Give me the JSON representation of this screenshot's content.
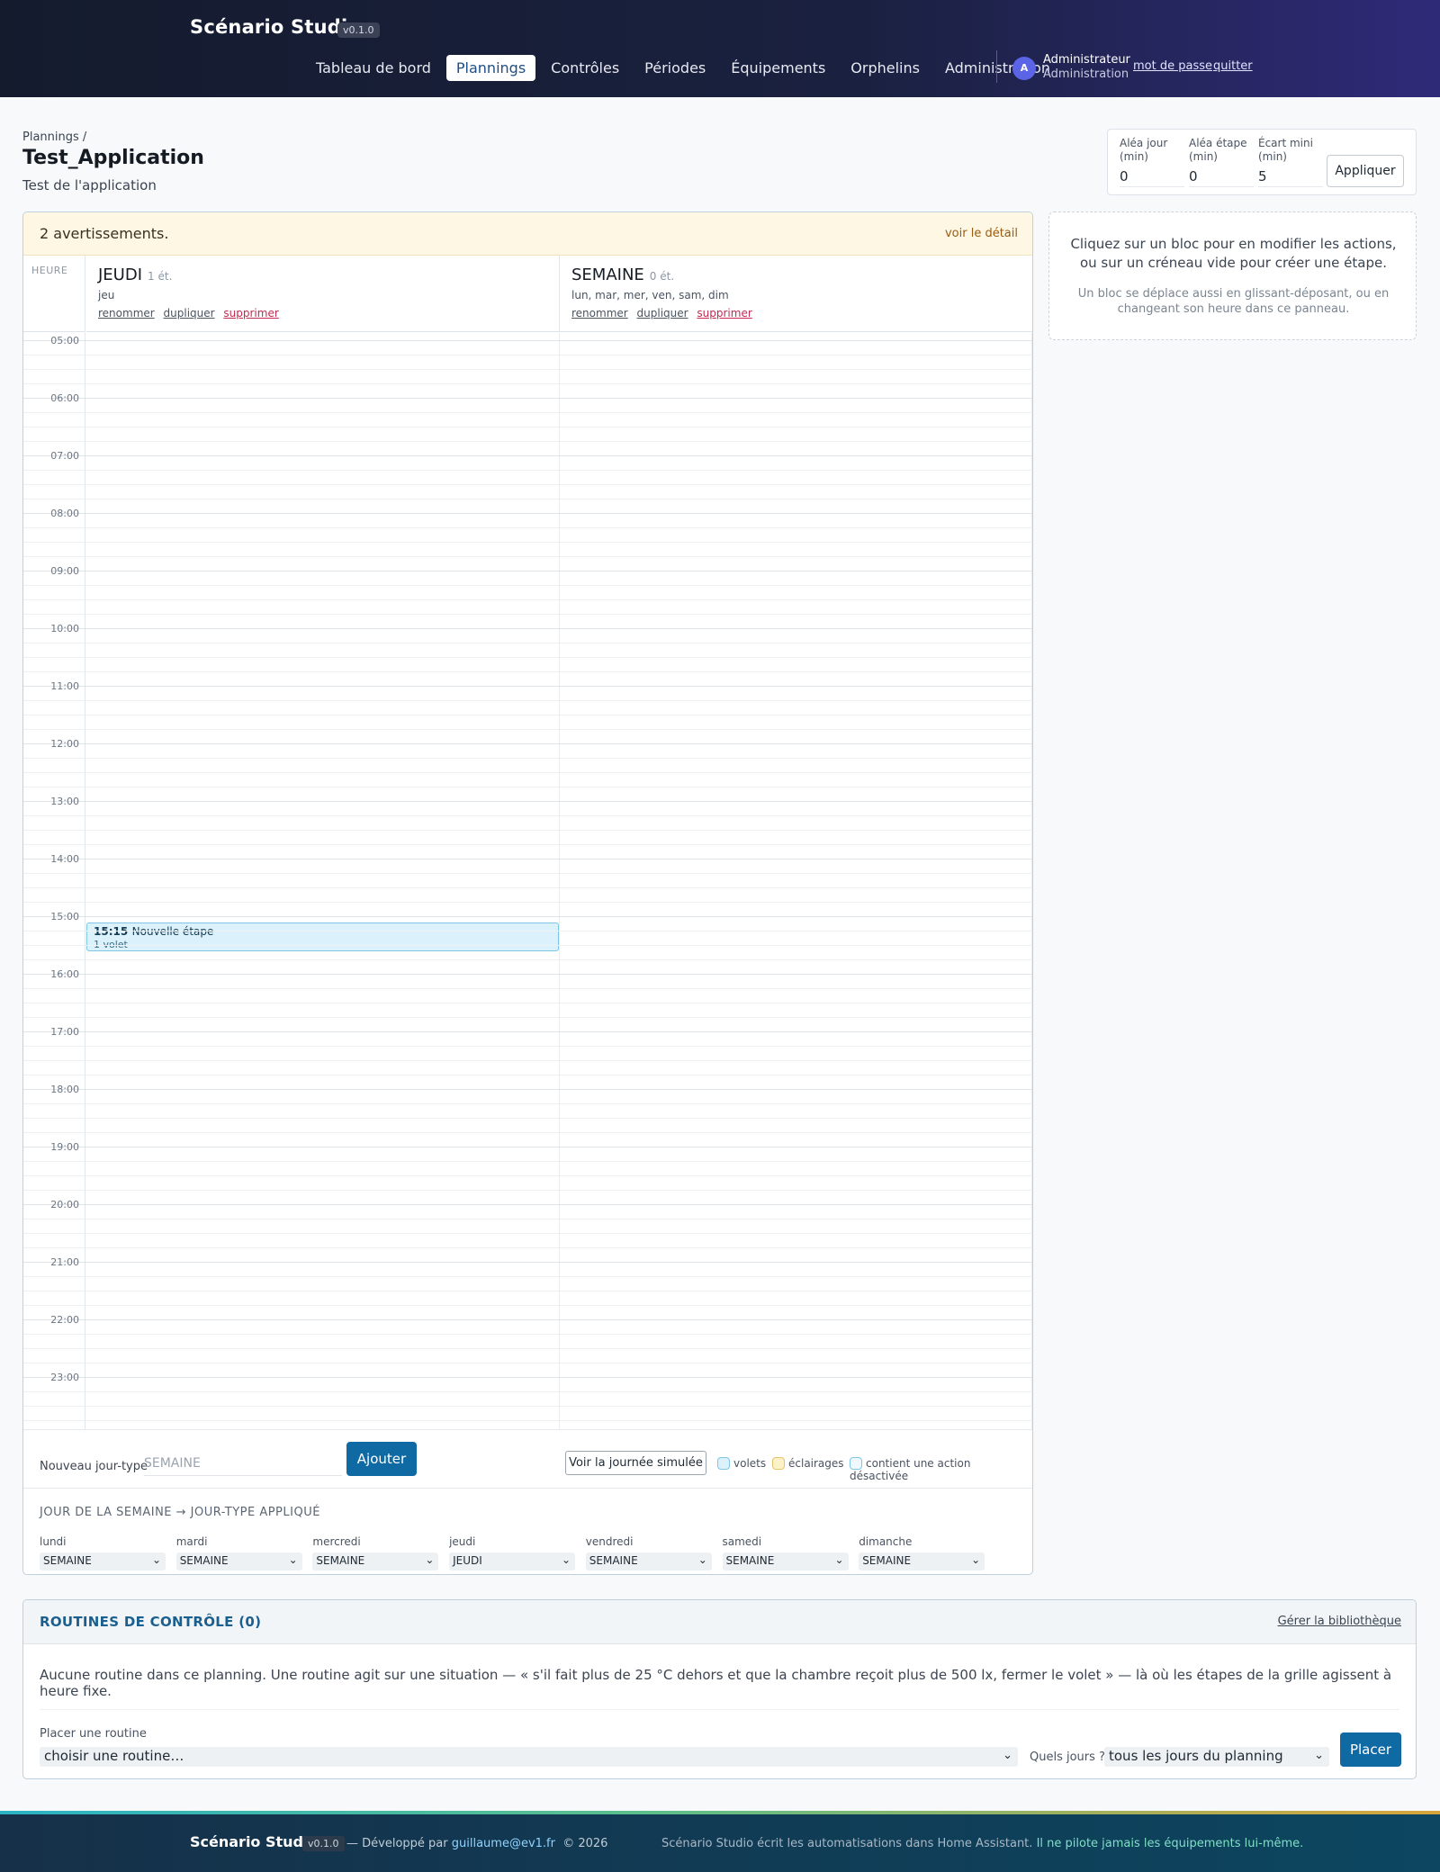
{
  "header": {
    "brand": "Scénario Studio",
    "version": "v0.1.0",
    "nav": [
      "Tableau de bord",
      "Plannings",
      "Contrôles",
      "Périodes",
      "Équipements",
      "Orphelins",
      "Administration"
    ],
    "active_nav": "Plannings",
    "user_initial": "A",
    "user_name": "Administrateur",
    "user_role": "Administration",
    "password_link": "mot de passe",
    "logout_link": "quitter"
  },
  "page": {
    "breadcrumb": "Plannings /",
    "title": "Test_Application",
    "subtitle": "Test de l'application"
  },
  "alea": {
    "jour_label": "Aléa jour (min)",
    "jour_value": "0",
    "etape_label": "Aléa étape (min)",
    "etape_value": "0",
    "ecart_label": "Écart mini (min)",
    "ecart_value": "5",
    "apply": "Appliquer"
  },
  "warning": {
    "text": "2 avertissements.",
    "link": "voir le détail"
  },
  "grid": {
    "heure_label": "HEURE",
    "hours": [
      "05:00",
      "06:00",
      "07:00",
      "08:00",
      "09:00",
      "10:00",
      "11:00",
      "12:00",
      "13:00",
      "14:00",
      "15:00",
      "16:00",
      "17:00",
      "18:00",
      "19:00",
      "20:00",
      "21:00",
      "22:00",
      "23:00"
    ],
    "days": [
      {
        "name": "JEUDI",
        "count": "1 ét.",
        "weekdays": "jeu"
      },
      {
        "name": "SEMAINE",
        "count": "0 ét.",
        "weekdays": "lun, mar, mer, ven, sam, dim"
      }
    ],
    "rename": "renommer",
    "duplicate": "dupliquer",
    "delete": "supprimer",
    "block": {
      "time": "15:15",
      "name": "Nouvelle étape",
      "detail": "1 volet"
    }
  },
  "new_daytype": {
    "label": "Nouveau jour-type",
    "placeholder": "SEMAINE",
    "add": "Ajouter",
    "simulate": "Voir la journée simulée",
    "legend": [
      {
        "label": "volets",
        "color": "#dbf1fb",
        "border": "#7fc6e4"
      },
      {
        "label": "éclairages",
        "color": "#fdf1c8",
        "border": "#e4c566"
      },
      {
        "label": "contient une action désactivée",
        "color": "#eef8fd",
        "border": "#7fc6e4"
      }
    ]
  },
  "week_map": {
    "heading": "JOUR DE LA SEMAINE → JOUR-TYPE APPLIQUÉ",
    "days": [
      {
        "day": "lundi",
        "value": "SEMAINE"
      },
      {
        "day": "mardi",
        "value": "SEMAINE"
      },
      {
        "day": "mercredi",
        "value": "SEMAINE"
      },
      {
        "day": "jeudi",
        "value": "JEUDI"
      },
      {
        "day": "vendredi",
        "value": "SEMAINE"
      },
      {
        "day": "samedi",
        "value": "SEMAINE"
      },
      {
        "day": "dimanche",
        "value": "SEMAINE"
      }
    ]
  },
  "help": {
    "main": "Cliquez sur un bloc pour en modifier les actions, ou sur un créneau vide pour créer une étape.",
    "hint": "Un bloc se déplace aussi en glissant-déposant, ou en changeant son heure dans ce panneau."
  },
  "routines": {
    "title": "ROUTINES DE CONTRÔLE (0)",
    "manage": "Gérer la bibliothèque",
    "empty": "Aucune routine dans ce planning. Une routine agit sur une situation — « s'il fait plus de 25 °C dehors et que la chambre reçoit plus de 500 lx, fermer le volet » — là où les étapes de la grille agissent à heure fixe.",
    "place_label": "Placer une routine",
    "choose": "choisir une routine…",
    "days_label": "Quels jours ?",
    "days_value": "tous les jours du planning",
    "place_btn": "Placer"
  },
  "footer": {
    "brand": "Scénario Studio",
    "version": "v0.1.0",
    "dev_prefix": "— Développé par",
    "dev_email": "guillaume@ev1.fr",
    "copyright": "© 2026",
    "note": "Scénario Studio écrit les automatisations dans Home Assistant.",
    "note_highlight": "Il ne pilote jamais les équipements lui-même."
  },
  "colors": {
    "accent": "#0f6aa4",
    "active_nav_text": "#1e4f86",
    "delete": "#c6284f"
  }
}
